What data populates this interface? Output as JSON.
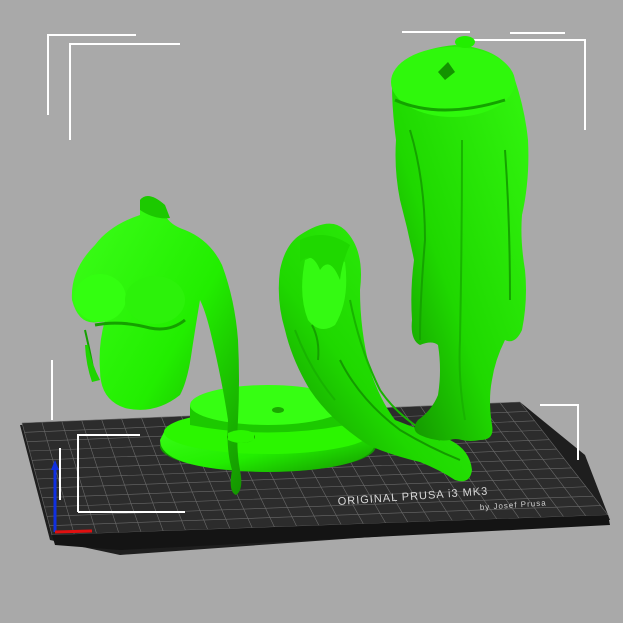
{
  "viewport": {
    "background_color": "#a9a9a9",
    "model_color": "#22ee00",
    "bed_color": "#2a2a2a",
    "grid_color": "#6e6e6e"
  },
  "bed": {
    "label": "ORIGINAL PRUSA i3 MK3",
    "sublabel": "by Josef Prusa"
  },
  "objects": [
    {
      "name": "torso-with-arm"
    },
    {
      "name": "round-base"
    },
    {
      "name": "head-with-hair"
    },
    {
      "name": "legs-with-skirt"
    }
  ],
  "axes": {
    "x_color": "#e01010",
    "z_color": "#1030e0"
  }
}
